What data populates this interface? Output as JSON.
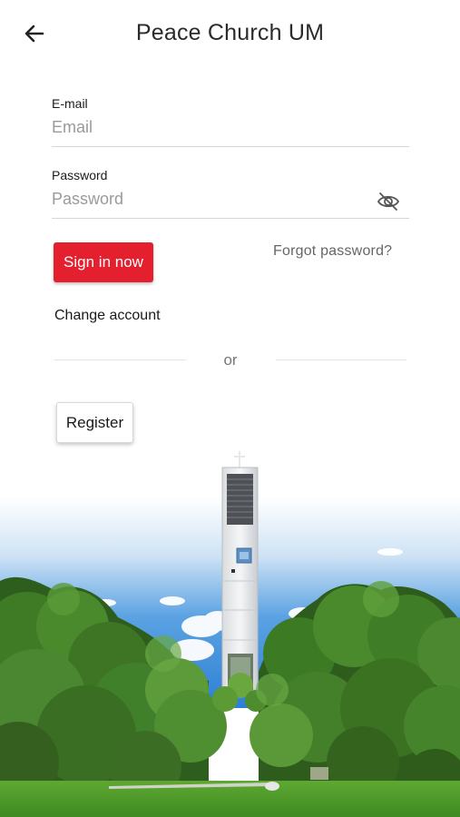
{
  "header": {
    "title": "Peace Church UM",
    "back_icon": "arrow-left-icon"
  },
  "form": {
    "email_label": "E-mail",
    "email_placeholder": "Email",
    "email_value": "",
    "password_label": "Password",
    "password_placeholder": "Password",
    "password_value": "",
    "password_visibility_icon": "eye-off-icon"
  },
  "actions": {
    "signin_label": "Sign in now",
    "forgot_label": "Forgot password?",
    "change_account_label": "Change account",
    "divider_label": "or",
    "register_label": "Register"
  },
  "colors": {
    "primary": "#e5202e",
    "sky": "#2f86d8",
    "grass": "#4e9a2a"
  },
  "background": {
    "description_icon": "church-bell-tower-illustration"
  }
}
